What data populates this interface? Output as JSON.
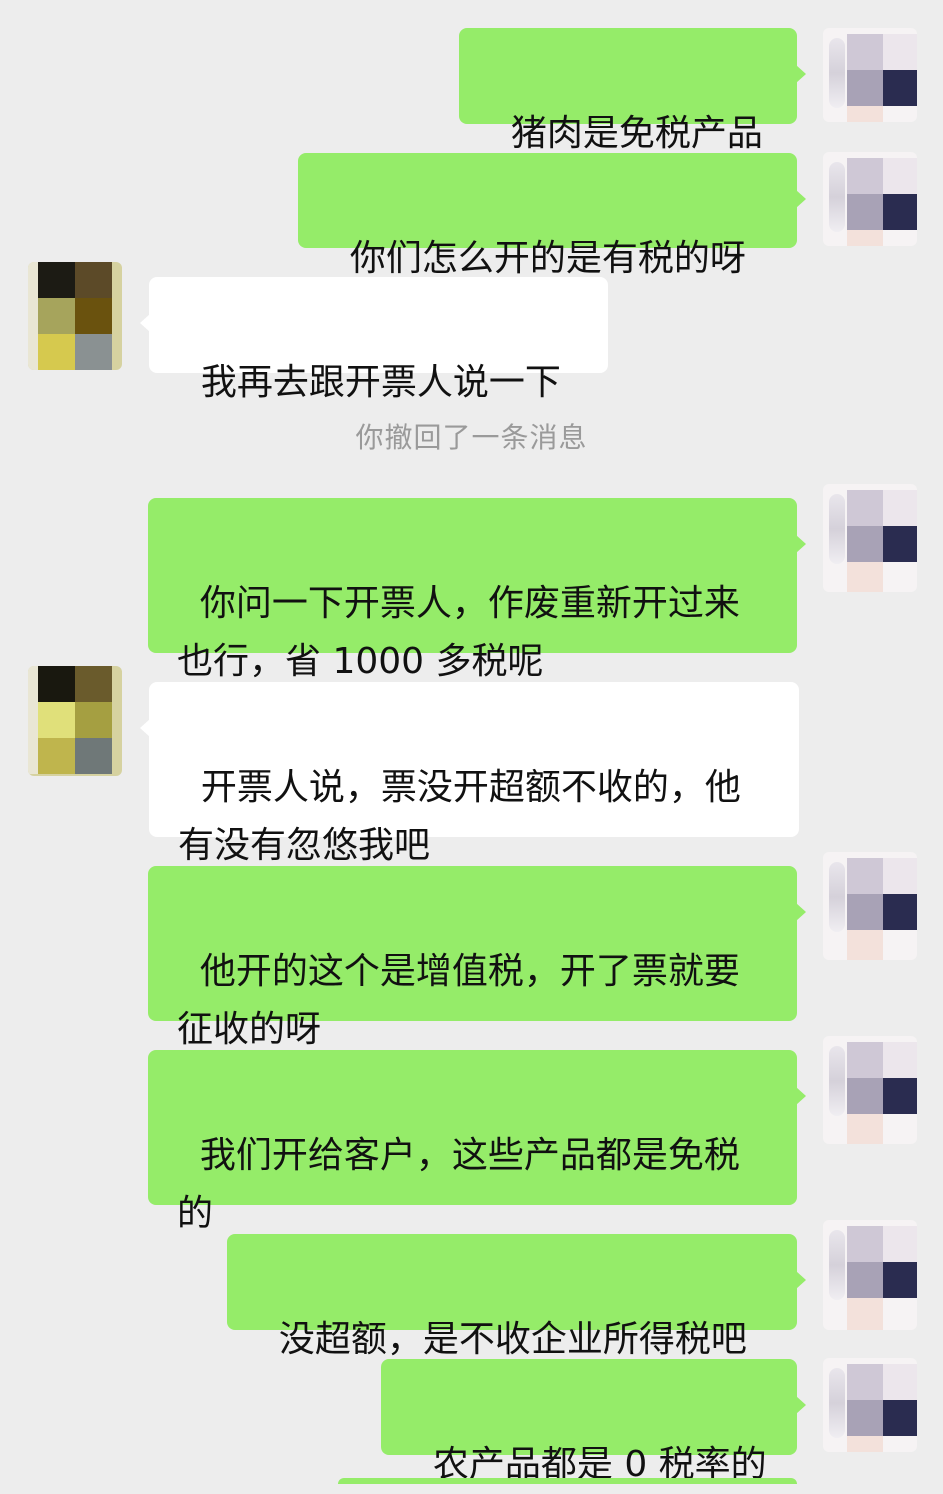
{
  "chat": {
    "messages": [
      {
        "id": "m1",
        "side": "out",
        "text": "猪肉是免税产品"
      },
      {
        "id": "m2",
        "side": "out",
        "text": "你们怎么开的是有税的呀"
      },
      {
        "id": "m3",
        "side": "in",
        "text": "我再去跟开票人说一下"
      },
      {
        "id": "m4",
        "side": "out",
        "text": "你问一下开票人，作废重新开过来也行，省 1000 多税呢"
      },
      {
        "id": "m5",
        "side": "in",
        "text": "开票人说，票没开超额不收的，他有没有忽悠我吧"
      },
      {
        "id": "m6",
        "side": "out",
        "text": "他开的这个是增值税，开了票就要征收的呀"
      },
      {
        "id": "m7",
        "side": "out",
        "text": "我们开给客户，这些产品都是免税的"
      },
      {
        "id": "m8",
        "side": "out",
        "text": "没超额，是不收企业所得税吧"
      },
      {
        "id": "m9",
        "side": "out",
        "text": "农产品都是 0 税率的"
      }
    ],
    "system_notice": "你撤回了一条消息"
  },
  "colors": {
    "background": "#ededed",
    "outgoing_bubble": "#95ec69",
    "incoming_bubble": "#ffffff",
    "system_text": "#9a9a9a"
  }
}
